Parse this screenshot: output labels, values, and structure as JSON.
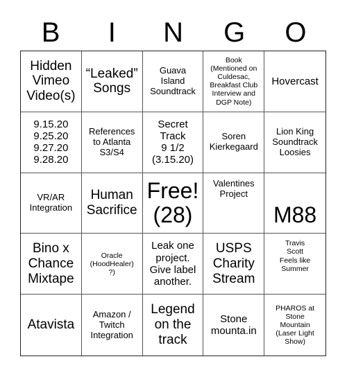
{
  "header": {
    "letters": [
      "B",
      "I",
      "N",
      "G",
      "O"
    ]
  },
  "cells": [
    "Hidden\nVimeo\nVideo(s)",
    "“Leaked”\nSongs",
    "Guava\nIsland\nSoundtrack",
    "Book\n(Mentioned on\nCuldesac,\nBreakfast Club\nInterview and\nDGP Note)",
    "Hovercast",
    "9.15.20\n9.25.20\n9.27.20\n9.28.20",
    "References\nto Atlanta\nS3/S4",
    "Secret\nTrack\n9 1/2\n(3.15.20)",
    "Soren\nKierkegaard",
    "Lion King\nSoundtrack\nLoosies",
    "VR/AR\nIntegration",
    "Human\nSacrifice",
    "Free!\n(28)",
    "Valentines\nProject",
    "M88",
    "Bino x\nChance\nMixtape",
    "Oracle\n(HoodHealer)\n?)",
    "Leak one\nproject.\nGive label\nanother.",
    "USPS\nCharity\nStream",
    "Travis\nScott\nFeels like\nSummer",
    "Atavista",
    "Amazon /\nTwitch\nIntegration",
    "Legend\non the\ntrack",
    "Stone\nmounta.in",
    "PHAROS at\nStone\nMountain\n(Laser Light\nShow)"
  ]
}
